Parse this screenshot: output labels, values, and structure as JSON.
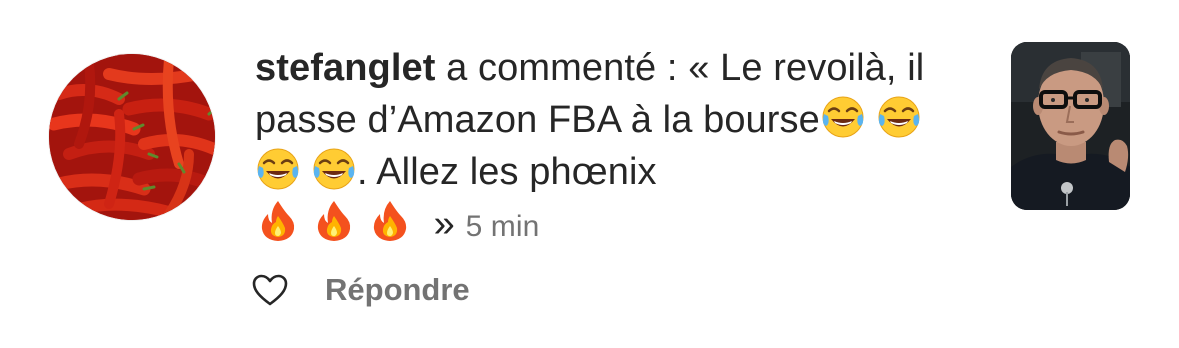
{
  "notification": {
    "username": "stefanglet",
    "action_text": "a commenté : « Le revoilà, il passe d’Amazon FBA à la bourse",
    "laugh_emoji_count": 4,
    "after_laugh_text": ". Allez les phœnix",
    "fire_emoji_count": 3,
    "closing_quote": "»",
    "timestamp": "5 min",
    "avatar_icon": "red-chili-peppers-photo",
    "thumbnail_icon": "man-with-glasses-video-thumbnail"
  },
  "actions": {
    "like_icon": "heart-outline-icon",
    "reply_label": "Répondre"
  },
  "colors": {
    "text_primary": "#262626",
    "text_secondary": "#737373",
    "background": "#ffffff"
  }
}
